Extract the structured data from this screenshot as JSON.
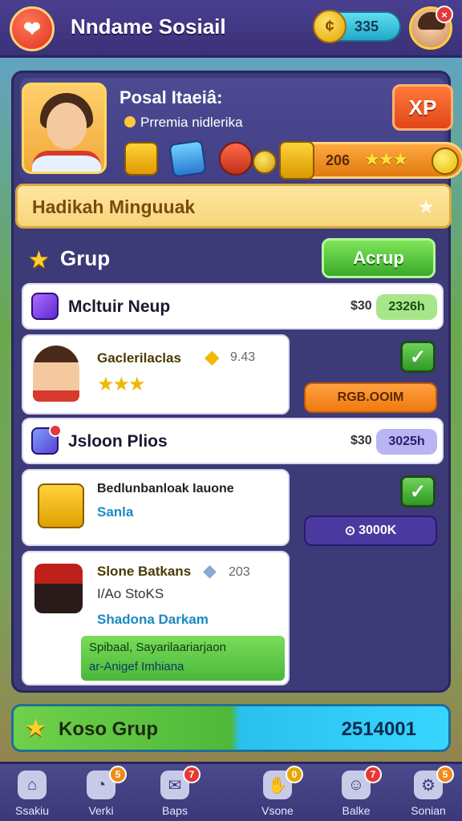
{
  "header": {
    "logo_icon": "app-logo-icon",
    "title": "Nndame Sosiail",
    "coins": "335",
    "avatar_badge": "×"
  },
  "profile": {
    "name": "Posal Itaeiâ:",
    "subtitle": "Prremia nidlerika",
    "xp_label": "XP",
    "reward_value": "206",
    "reward_stars": "★★★"
  },
  "banner": {
    "text": "Hadikah Minguuak"
  },
  "group_section": {
    "title": "Grup",
    "button_label": "Acrup"
  },
  "rows": [
    {
      "title": "Mcltuir Neup",
      "price": "$30",
      "value": "2326h",
      "value_color": "#a8e68a"
    },
    {
      "title": "Gaclerilaclas",
      "meta": "9.43",
      "stars": "★★★",
      "action_label": "RGB.OOIM",
      "checked": true
    },
    {
      "title": "Jsloon Plios",
      "price": "$30",
      "value": "3025h",
      "value_color": "#b9b5f2"
    },
    {
      "title": "Bedlunbanloak Iauone",
      "subtitle": "Sanla",
      "action_label": "3000K",
      "checked": true
    },
    {
      "title": "Slone Batkans",
      "meta": "203",
      "line2": "I/Ao StoKS",
      "subtitle": "Shadona Darkam",
      "banner": "Spibaal, Sayarilaariarjaon",
      "banner2": "ar-Anigef Imhiana"
    }
  ],
  "group_bar": {
    "label": "Koso Grup",
    "value": "2514001"
  },
  "nav": [
    {
      "label": "Ssakiu",
      "icon": "home-icon"
    },
    {
      "label": "Verki",
      "icon": "chart-icon",
      "badge": "5",
      "badge_color": "#f08a1a"
    },
    {
      "label": "Baps",
      "icon": "mail-icon",
      "badge": "7",
      "badge_color": "#e53935"
    },
    {
      "label": "Vsone",
      "icon": "hand-icon",
      "badge": "0",
      "badge_color": "#e8a800"
    },
    {
      "label": "Balke",
      "icon": "people-icon",
      "badge": "7",
      "badge_color": "#e53935"
    },
    {
      "label": "Sonian",
      "icon": "gear-icon",
      "badge": "5",
      "badge_color": "#f08a1a"
    }
  ]
}
